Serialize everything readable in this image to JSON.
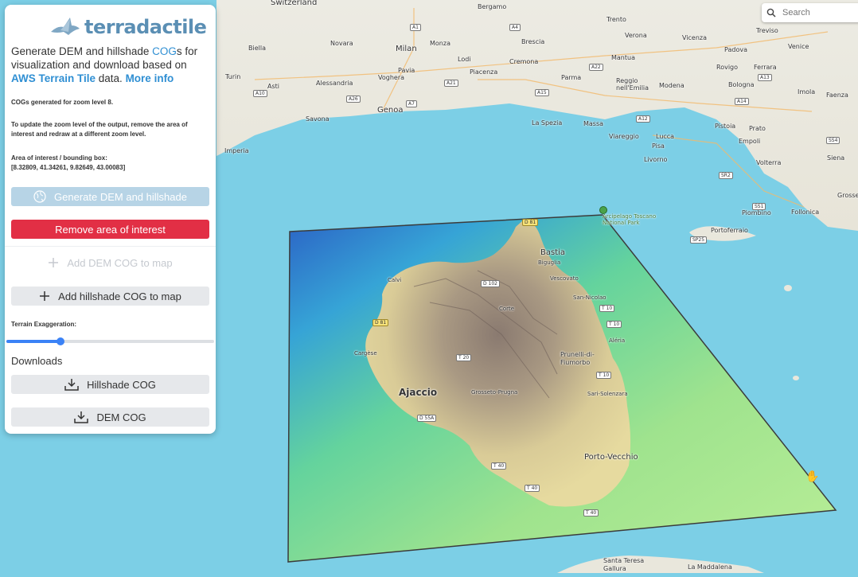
{
  "search": {
    "placeholder": "Search"
  },
  "panel": {
    "logo_text": "terradactile",
    "intro": {
      "p1": "Generate DEM and hillshade ",
      "cog_link": "COG",
      "p2": "s for visualization and download based on ",
      "aws_link": "AWS Terrain Tile",
      "p3": " data. ",
      "more_link": "More info"
    },
    "zoom_note": "COGs generated for zoom level 8.",
    "update_note": "To update the zoom level of the output, remove the area of interest and redraw at a different zoom level.",
    "aoi_label": "Area of interest / bounding box:",
    "aoi_value": "[8.32809, 41.34261, 9.82649, 43.00083]",
    "generate_label": "Generate DEM and hillshade",
    "remove_label": "Remove area of interest",
    "add_dem_label": "Add DEM COG to map",
    "add_hillshade_label": "Add hillshade COG to map",
    "exaggeration_label": "Terrain Exaggeration:",
    "exaggeration_value": 0.26,
    "downloads_title": "Downloads",
    "hillshade_cog_label": "Hillshade COG",
    "dem_cog_label": "DEM COG"
  },
  "colors": {
    "accent": "#3b82f6",
    "danger": "#e22f45",
    "logo": "#5b8fb4",
    "water": "#7ccfe6"
  },
  "map": {
    "places": [
      {
        "t": "Switzerland",
        "c": "lg"
      },
      {
        "t": "Bergamo",
        "c": "md"
      },
      {
        "t": "Treviso",
        "c": "md"
      },
      {
        "t": "Novara",
        "c": "md"
      },
      {
        "t": "Milan",
        "c": "lg"
      },
      {
        "t": "Brescia",
        "c": "md"
      },
      {
        "t": "Vicenza",
        "c": "md"
      },
      {
        "t": "Padova",
        "c": "md"
      },
      {
        "t": "Venice",
        "c": "md"
      },
      {
        "t": "Turin",
        "c": "md"
      },
      {
        "t": "Biella",
        "c": "md"
      },
      {
        "t": "Pavia",
        "c": "md"
      },
      {
        "t": "Piacenza",
        "c": "md"
      },
      {
        "t": "Cremona",
        "c": "md"
      },
      {
        "t": "Mantua",
        "c": "md"
      },
      {
        "t": "Rovigo",
        "c": "md"
      },
      {
        "t": "Verona",
        "c": "md"
      },
      {
        "t": "Trento",
        "c": "md"
      },
      {
        "t": "Monza",
        "c": "md"
      },
      {
        "t": "Lodi",
        "c": "md"
      },
      {
        "t": "Asti",
        "c": "md"
      },
      {
        "t": "Alessandria",
        "c": "md"
      },
      {
        "t": "Voghera",
        "c": "md"
      },
      {
        "t": "Parma",
        "c": "md"
      },
      {
        "t": "Reggio nell'Emilia",
        "c": "md"
      },
      {
        "t": "Modena",
        "c": "md"
      },
      {
        "t": "Bologna",
        "c": "md"
      },
      {
        "t": "Ferrara",
        "c": "md"
      },
      {
        "t": "Imola",
        "c": "md"
      },
      {
        "t": "Faenza",
        "c": "md"
      },
      {
        "t": "Genoa",
        "c": "lg"
      },
      {
        "t": "Savona",
        "c": "md"
      },
      {
        "t": "Imperia",
        "c": "md"
      },
      {
        "t": "La Spezia",
        "c": "md"
      },
      {
        "t": "Massa",
        "c": "md"
      },
      {
        "t": "Pistoia",
        "c": "md"
      },
      {
        "t": "Prato",
        "c": "md"
      },
      {
        "t": "Lucca",
        "c": "md"
      },
      {
        "t": "Pisa",
        "c": "md"
      },
      {
        "t": "Livorno",
        "c": "md"
      },
      {
        "t": "Empoli",
        "c": "md"
      },
      {
        "t": "Viareggio",
        "c": "md"
      },
      {
        "t": "Volterra",
        "c": "md"
      },
      {
        "t": "Siena",
        "c": "md"
      },
      {
        "t": "Grosseto",
        "c": "md"
      },
      {
        "t": "Piombino",
        "c": "md"
      },
      {
        "t": "Follonica",
        "c": "md"
      },
      {
        "t": "Portoferraio",
        "c": "md"
      },
      {
        "t": "Bastia",
        "c": "lg"
      },
      {
        "t": "Biguglia",
        "c": "sm"
      },
      {
        "t": "Calvi",
        "c": "sm"
      },
      {
        "t": "Corte",
        "c": "sm"
      },
      {
        "t": "Vescovato",
        "c": "sm"
      },
      {
        "t": "San-Nicolao",
        "c": "sm"
      },
      {
        "t": "Aléria",
        "c": "sm"
      },
      {
        "t": "Cargèse",
        "c": "sm"
      },
      {
        "t": "Prunelli-di-Fiumorbo",
        "c": "md"
      },
      {
        "t": "Ajaccio",
        "c": "xl"
      },
      {
        "t": "Grosseto-Prugna",
        "c": "sm"
      },
      {
        "t": "Sari-Solenzara",
        "c": "sm"
      },
      {
        "t": "Porto-Vecchio",
        "c": "lg"
      },
      {
        "t": "Santa Teresa Gallura",
        "c": "md"
      },
      {
        "t": "La Maddalena",
        "c": "md"
      },
      {
        "t": "Arcipelago Toscano National Park",
        "c": "sm"
      }
    ],
    "shields": [
      "D 81",
      "D 81",
      "T 10",
      "T 10",
      "T 20",
      "T 40",
      "T 40",
      "T 40",
      "D 55A",
      "T 10",
      "D 102",
      "A1",
      "A4",
      "A21",
      "A7",
      "A26",
      "A10",
      "A15",
      "A12",
      "A22",
      "A13",
      "A14",
      "SS1",
      "SR2",
      "SS4",
      "SP25"
    ]
  }
}
